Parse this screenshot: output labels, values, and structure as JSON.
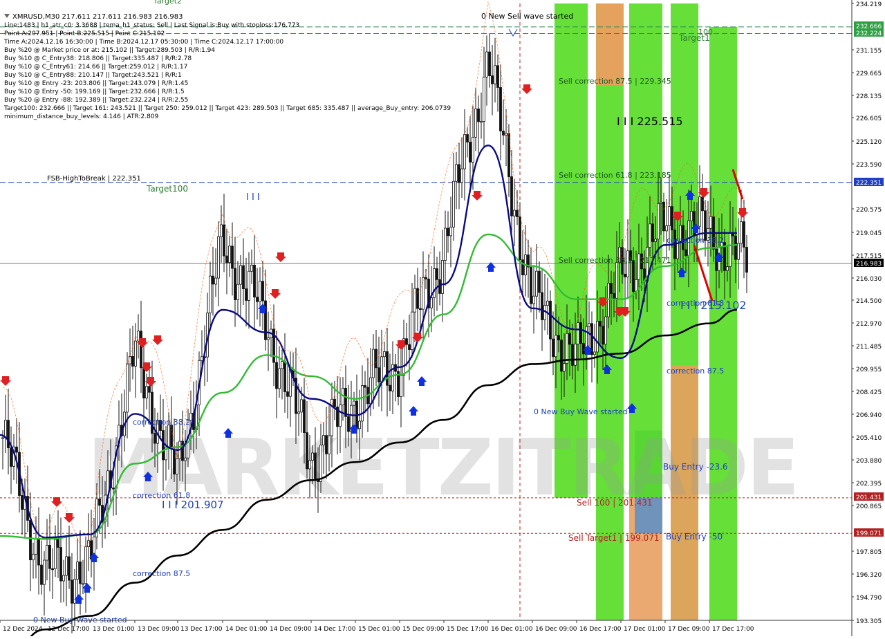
{
  "window": {
    "title_line": "XMRUSD,M30  217.611 217.611 216.983 216.983",
    "bg_color": "#ffffff",
    "axis_color": "#333333"
  },
  "info_lines": [
    "Line:1483 | h1_atr_c0: 3.3688 | tema_h1_status: Sell | Last Signal is:Buy with stoploss:176.773",
    "Point A:207.951 | Point B:225.515 | Point C:215.102",
    "Time A:2024.12.16 16:30:00 | Time B:2024.12.17 05:30:00 | Time C:2024.12.17 17:00:00",
    "Buy %20 @ Market price or at: 215.102 || Target:289.503 | R/R:1.94",
    "Buy %10 @ C_Entry38: 218.806 || Target:335.487 | R/R:2.78",
    "Buy %10 @ C_Entry61: 214.66 || Target:259.012 | R/R:1.17",
    "Buy %10 @ C_Entry88: 210.147 || Target:243.521 | R/R:1",
    "Buy %10 @ Entry -23: 203.806 || Target:243.079 | R/R:1.45",
    "Buy %10 @ Entry -50: 199.169 || Target:232.666 | R/R:1.5",
    "Buy %20 @ Entry -88: 192.389 || Target:232.224 | R/R:2.55",
    "Target100: 232.666 || Target 161: 243.521 || Target 250: 259.012 || Target 423: 289.503 || Target 685: 335.487 || average_Buy_entry: 206.0739",
    "minimum_distance_buy_levels: 4.146 | ATR:2.809"
  ],
  "chart_data": {
    "type": "line",
    "symbol": "XMRUSD",
    "timeframe": "M30",
    "ylim": [
      193.305,
      234.219
    ],
    "y_ticks": [
      "234.219",
      "232.666",
      "232.224",
      "231.155",
      "229.665",
      "228.135",
      "226.605",
      "225.120",
      "223.590",
      "222.351",
      "220.575",
      "219.045",
      "217.515",
      "216.983",
      "216.030",
      "214.500",
      "212.970",
      "211.485",
      "209.955",
      "208.425",
      "206.940",
      "205.410",
      "203.880",
      "202.395",
      "201.431",
      "200.865",
      "199.071",
      "197.805",
      "196.320",
      "194.790",
      "193.305"
    ],
    "x_ticks": [
      "12 Dec 2024",
      "12 Dec 17:00",
      "13 Dec 01:00",
      "13 Dec 09:00",
      "13 Dec 17:00",
      "14 Dec 01:00",
      "14 Dec 09:00",
      "14 Dec 17:00",
      "15 Dec 01:00",
      "15 Dec 09:00",
      "15 Dec 17:00",
      "16 Dec 01:00",
      "16 Dec 09:00",
      "16 Dec 17:00",
      "17 Dec 01:00",
      "17 Dec 09:00",
      "17 Dec 17:00"
    ],
    "current_price": 216.983,
    "price_labels": [
      {
        "text": "232.666",
        "value": 232.666,
        "color": "#2ea043"
      },
      {
        "text": "232.224",
        "value": 232.224,
        "color": "#2ea043"
      },
      {
        "text": "222.351",
        "value": 222.351,
        "color": "#1f3fbf"
      },
      {
        "text": "216.983",
        "value": 216.983,
        "color": "#000000"
      },
      {
        "text": "201.431",
        "value": 201.431,
        "color": "#b22222"
      },
      {
        "text": "199.071",
        "value": 199.071,
        "color": "#b22222"
      }
    ],
    "levels": [
      {
        "name": "target-100",
        "value": 232.666,
        "color": "#2e8b57",
        "style": "dash"
      },
      {
        "name": "target-161",
        "value": 232.224,
        "color": "#2e8b57",
        "style": "dash"
      },
      {
        "name": "fsb-high-to-break",
        "value": 222.351,
        "color": "#1f3fbf",
        "style": "dash"
      },
      {
        "name": "current-price",
        "value": 216.983,
        "color": "#777777",
        "style": "solid"
      },
      {
        "name": "sell-100",
        "value": 201.431,
        "color": "#b22222",
        "style": "dot"
      },
      {
        "name": "sell-target1",
        "value": 199.071,
        "color": "#b22222",
        "style": "dot"
      }
    ],
    "vline_label": "16 Dec 01:00",
    "zones": [
      {
        "name": "sell-zone-1",
        "from": "16 Dec 09:00",
        "to": "16 Dec 17:00",
        "ylim": [
          201.431,
          234.219
        ],
        "color": "#55dd22"
      },
      {
        "name": "sell-zone-2",
        "from": "16 Dec 17:00",
        "to": "17 Dec 01:00",
        "ylim": [
          193.305,
          234.219
        ],
        "color": "#55dd22"
      },
      {
        "name": "buy-zone-1",
        "from": "17 Dec 09:00",
        "to": "17 Dec 17:00",
        "ylim": [
          193.305,
          234.219
        ],
        "color": "#55dd22"
      },
      {
        "name": "buy-zone-2",
        "from": "17 Dec 17:00",
        "to": "17 Dec 21:00",
        "ylim": [
          193.305,
          232.666
        ],
        "color": "#55dd22"
      },
      {
        "name": "orange-zone-1",
        "from": "16 Dec 17:00",
        "to": "17 Dec 01:00",
        "ylim": [
          228.8,
          234.219
        ],
        "color": "#e8a060"
      },
      {
        "name": "orange-zone-2",
        "from": "17 Dec 01:00",
        "to": "17 Dec 05:00",
        "ylim": [
          193.305,
          201.431
        ],
        "color": "#e8a060"
      },
      {
        "name": "orange-zone-3",
        "from": "17 Dec 09:00",
        "to": "17 Dec 17:00",
        "ylim": [
          193.305,
          210.2
        ],
        "color": "#e8a060"
      },
      {
        "name": "blue-zone",
        "from": "17 Dec 01:00",
        "to": "17 Dec 05:00",
        "ylim": [
          199.071,
          205.9
        ],
        "color": "#5b8fc8"
      }
    ],
    "series": [
      {
        "color": "#000000",
        "width": 2.6,
        "x": [
          "12 Dec 2024",
          "12 Dec 17:00",
          "13 Dec 01:00",
          "13 Dec 09:00",
          "13 Dec 17:00",
          "14 Dec 01:00",
          "14 Dec 09:00",
          "14 Dec 17:00",
          "15 Dec 01:00",
          "15 Dec 09:00",
          "15 Dec 17:00",
          "16 Dec 01:00",
          "16 Dec 09:00",
          "16 Dec 17:00",
          "17 Dec 01:00",
          "17 Dec 09:00",
          "17 Dec 17:00",
          "17 Dec 21:00"
        ],
        "values": [
          190.0,
          192.7,
          193.6,
          195.8,
          197.6,
          199.3,
          201.3,
          202.6,
          203.8,
          205.1,
          206.6,
          208.9,
          210.3,
          210.6,
          211.0,
          212.2,
          213.0,
          213.9
        ]
      },
      {
        "color": "#33bb33",
        "width": 2.4,
        "x": [
          "12 Dec 2024",
          "12 Dec 17:00",
          "13 Dec 01:00",
          "13 Dec 09:00",
          "13 Dec 17:00",
          "14 Dec 01:00",
          "14 Dec 09:00",
          "14 Dec 17:00",
          "15 Dec 01:00",
          "15 Dec 09:00",
          "15 Dec 17:00",
          "16 Dec 01:00",
          "16 Dec 09:00",
          "16 Dec 17:00",
          "17 Dec 01:00",
          "17 Dec 09:00",
          "17 Dec 17:00",
          "17 Dec 21:00"
        ],
        "values": [
          198.9,
          198.7,
          199.0,
          203.7,
          204.8,
          208.4,
          210.9,
          209.5,
          208.0,
          209.6,
          213.6,
          218.9,
          216.8,
          214.6,
          214.6,
          216.8,
          218.0,
          218.2
        ]
      },
      {
        "color": "#0a0a80",
        "width": 2.4,
        "x": [
          "12 Dec 2024",
          "12 Dec 17:00",
          "13 Dec 01:00",
          "13 Dec 09:00",
          "13 Dec 17:00",
          "14 Dec 01:00",
          "14 Dec 09:00",
          "14 Dec 17:00",
          "15 Dec 01:00",
          "15 Dec 09:00",
          "15 Dec 17:00",
          "16 Dec 01:00",
          "16 Dec 09:00",
          "16 Dec 17:00",
          "17 Dec 01:00",
          "17 Dec 09:00",
          "17 Dec 17:00",
          "17 Dec 21:00"
        ],
        "values": [
          205.6,
          198.8,
          199.0,
          207.0,
          204.6,
          213.9,
          212.4,
          208.0,
          206.9,
          210.1,
          215.6,
          224.8,
          214.0,
          212.6,
          210.7,
          218.2,
          219.0,
          219.0
        ]
      }
    ],
    "annotations": [
      {
        "text": "Target2",
        "color": "#2e7d32"
      },
      {
        "text": "0 New Sell wave started",
        "color": "#000000"
      },
      {
        "text": "100",
        "color": "#2e7d32"
      },
      {
        "text": "Target1",
        "color": "#2e7d32"
      },
      {
        "text": "Sell correction 87.5 | 229.345",
        "color": "#1a5a1a"
      },
      {
        "text": "I I I 225.515",
        "color": "#000000"
      },
      {
        "text": "FSB-HighToBreak | 222.351",
        "color": "#000000"
      },
      {
        "text": "Target100",
        "color": "#2e7d32"
      },
      {
        "text": "Sell correction 61.8 | 223.185",
        "color": "#1a5a1a"
      },
      {
        "text": "I I I",
        "color": "#1f3fbf"
      },
      {
        "text": "correction 38.2",
        "color": "#1f3fbf"
      },
      {
        "text": "Sell correction 38.2 | 217.471",
        "color": "#1a5a1a"
      },
      {
        "text": "correction 61.8",
        "color": "#1f3fbf"
      },
      {
        "text": "I I I 215.102",
        "color": "#1f3fbf"
      },
      {
        "text": "correction 87.5",
        "color": "#1f3fbf"
      },
      {
        "text": "correction 38.2",
        "color": "#1f3fbf"
      },
      {
        "text": "0 New Buy Wave started",
        "color": "#1f3fbf"
      },
      {
        "text": "Buy Entry -23.6",
        "color": "#1f3fbf"
      },
      {
        "text": "correction 61.8",
        "color": "#1f3fbf"
      },
      {
        "text": "I I I 201.907",
        "color": "#1f3fbf"
      },
      {
        "text": "Sell 100 | 201.431",
        "color": "#b22222"
      },
      {
        "text": "Sell Target1 | 199.071",
        "color": "#b22222"
      },
      {
        "text": "Buy Entry -50",
        "color": "#1f3fbf"
      },
      {
        "text": "correction 87.5",
        "color": "#1f3fbf"
      },
      {
        "text": "0 New Buy Wave started",
        "color": "#1f3fbf"
      }
    ],
    "watermark": "MARKETZITRADE"
  }
}
